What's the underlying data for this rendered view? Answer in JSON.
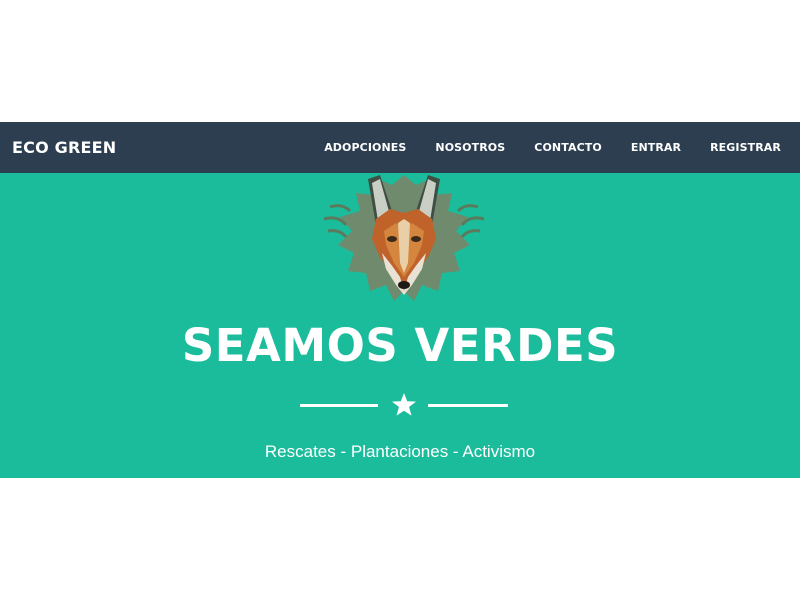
{
  "navbar": {
    "brand": "ECO GREEN",
    "links": [
      "ADOPCIONES",
      "NOSOTROS",
      "CONTACTO",
      "ENTRAR",
      "REGISTRAR"
    ]
  },
  "hero": {
    "image_icon": "maned-wolf-avatar",
    "title": "SEAMOS VERDES",
    "divider_icon": "star-icon",
    "subtitle": "Rescates - Plantaciones - Activismo"
  },
  "colors": {
    "navbar_bg": "#2c3e50",
    "hero_bg": "#1abc9c",
    "text": "#ffffff"
  }
}
